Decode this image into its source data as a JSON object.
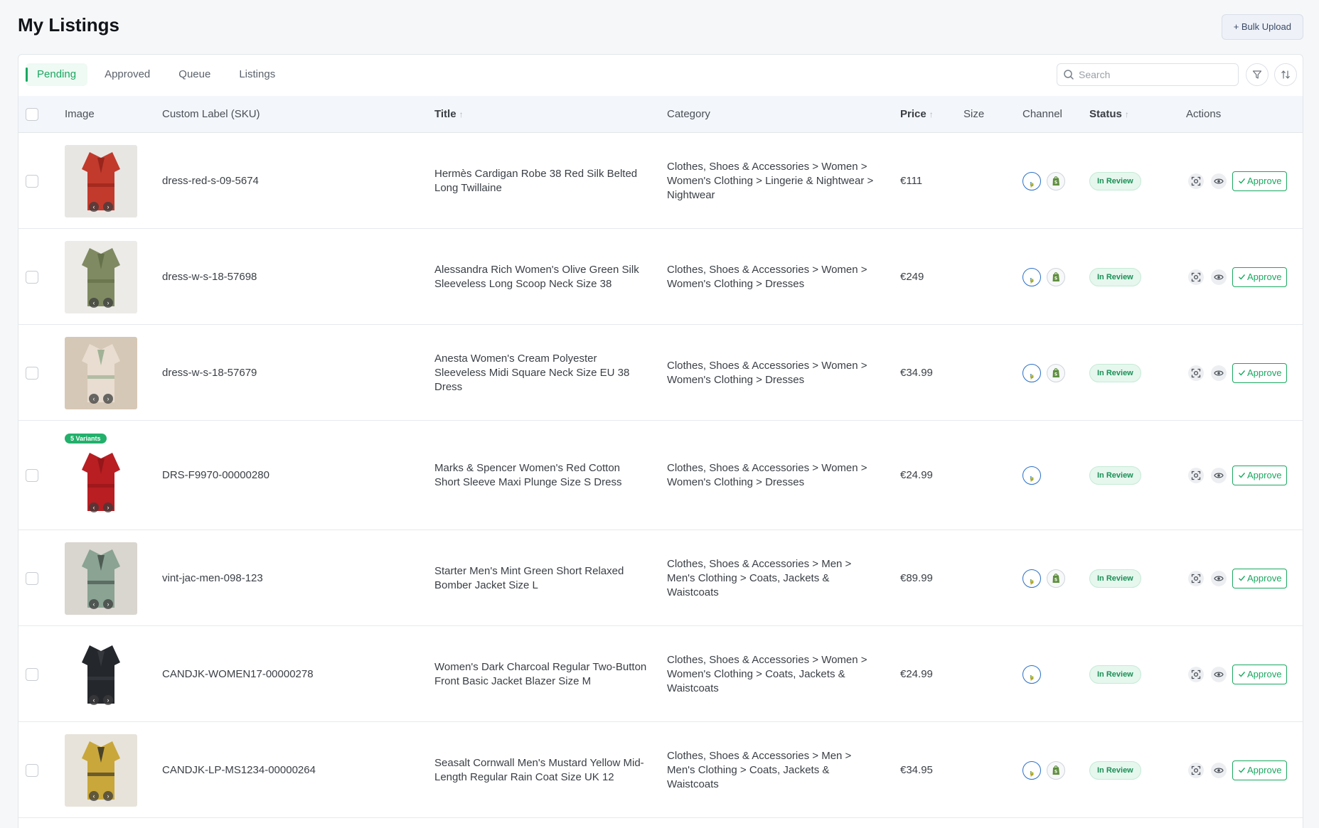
{
  "page": {
    "title": "My Listings",
    "bulk_upload_label": "+ Bulk Upload"
  },
  "tabs": [
    {
      "label": "Pending",
      "active": true
    },
    {
      "label": "Approved",
      "active": false
    },
    {
      "label": "Queue",
      "active": false
    },
    {
      "label": "Listings",
      "active": false
    }
  ],
  "search": {
    "placeholder": "Search",
    "value": ""
  },
  "table": {
    "headers": {
      "image": "Image",
      "sku": "Custom Label (SKU)",
      "title": "Title",
      "category": "Category",
      "price": "Price",
      "size": "Size",
      "channel": "Channel",
      "status": "Status",
      "actions": "Actions"
    },
    "approve_label": "Approve",
    "rows": [
      {
        "sku": "dress-red-s-09-5674",
        "title": "Hermès Cardigan Robe 38 Red Silk Belted Long Twillaine",
        "category": "Clothes, Shoes & Accessories > Women > Women's Clothing > Lingerie & Nightwear > Nightwear",
        "price": "€111",
        "size": "",
        "channels": [
          "ebay",
          "shopify"
        ],
        "status": "In Review",
        "variant_badge": "",
        "thumb_colors": [
          "#c23a2c",
          "#8f2019",
          "#e8e6e3"
        ]
      },
      {
        "sku": "dress-w-s-18-57698",
        "title": "Alessandra Rich Women's Olive Green Silk Sleeveless Long Scoop Neck Size 38",
        "category": "Clothes, Shoes & Accessories > Women > Women's Clothing > Dresses",
        "price": "€249",
        "size": "",
        "channels": [
          "ebay",
          "shopify"
        ],
        "status": "In Review",
        "variant_badge": "",
        "thumb_colors": [
          "#7f8a62",
          "#5f6a45",
          "#ecebe8"
        ]
      },
      {
        "sku": "dress-w-s-18-57679",
        "title": "Anesta Women's Cream Polyester Sleeveless Midi Square Neck Size EU 38 Dress",
        "category": "Clothes, Shoes & Accessories > Women > Women's Clothing > Dresses",
        "price": "€34.99",
        "size": "",
        "channels": [
          "ebay",
          "shopify"
        ],
        "status": "In Review",
        "variant_badge": "",
        "thumb_colors": [
          "#e8ddd0",
          "#8fa888",
          "#d6c8b6"
        ]
      },
      {
        "sku": "DRS-F9970-00000280",
        "title": "Marks & Spencer Women's Red Cotton Short Sleeve Maxi Plunge Size S Dress",
        "category": "Clothes, Shoes & Accessories > Women > Women's Clothing > Dresses",
        "price": "€24.99",
        "size": "",
        "channels": [
          "ebay"
        ],
        "status": "In Review",
        "variant_badge": "5 Variants",
        "thumb_colors": [
          "#b81e22",
          "#8d1418",
          "#ffffff"
        ]
      },
      {
        "sku": "vint-jac-men-098-123",
        "title": "Starter Men's Mint Green Short Relaxed Bomber Jacket Size L",
        "category": "Clothes, Shoes & Accessories > Men > Men's Clothing > Coats, Jackets & Waistcoats",
        "price": "€89.99",
        "size": "",
        "channels": [
          "ebay",
          "shopify"
        ],
        "status": "In Review",
        "variant_badge": "",
        "thumb_colors": [
          "#8aa393",
          "#3e4a44",
          "#d9d5cf"
        ]
      },
      {
        "sku": "CANDJK-WOMEN17-00000278",
        "title": "Women's Dark Charcoal Regular Two-Button Front Basic Jacket Blazer Size M",
        "category": "Clothes, Shoes & Accessories > Women > Women's Clothing > Coats, Jackets & Waistcoats",
        "price": "€24.99",
        "size": "",
        "channels": [
          "ebay"
        ],
        "status": "In Review",
        "variant_badge": "",
        "thumb_colors": [
          "#24272c",
          "#3a3e44",
          "#ffffff"
        ]
      },
      {
        "sku": "CANDJK-LP-MS1234-00000264",
        "title": "Seasalt Cornwall Men's Mustard Yellow Mid-Length Regular Rain Coat Size UK 12",
        "category": "Clothes, Shoes & Accessories > Men > Men's Clothing > Coats, Jackets & Waistcoats",
        "price": "€34.95",
        "size": "",
        "channels": [
          "ebay",
          "shopify"
        ],
        "status": "In Review",
        "variant_badge": "",
        "thumb_colors": [
          "#c9a73a",
          "#2b2a24",
          "#e7e3da"
        ]
      }
    ]
  },
  "icons": {
    "search": "search-icon",
    "filter": "filter-icon",
    "sort": "sort-icon",
    "preview": "focus-icon",
    "view": "eye-icon",
    "approve": "check-icon",
    "channel_ebay": "ebay-icon",
    "channel_shopify": "shopify-icon"
  },
  "colors": {
    "accent": "#1aa760",
    "status_bg": "#e6f7ee",
    "ebay_ring": "#2a6fc8"
  }
}
